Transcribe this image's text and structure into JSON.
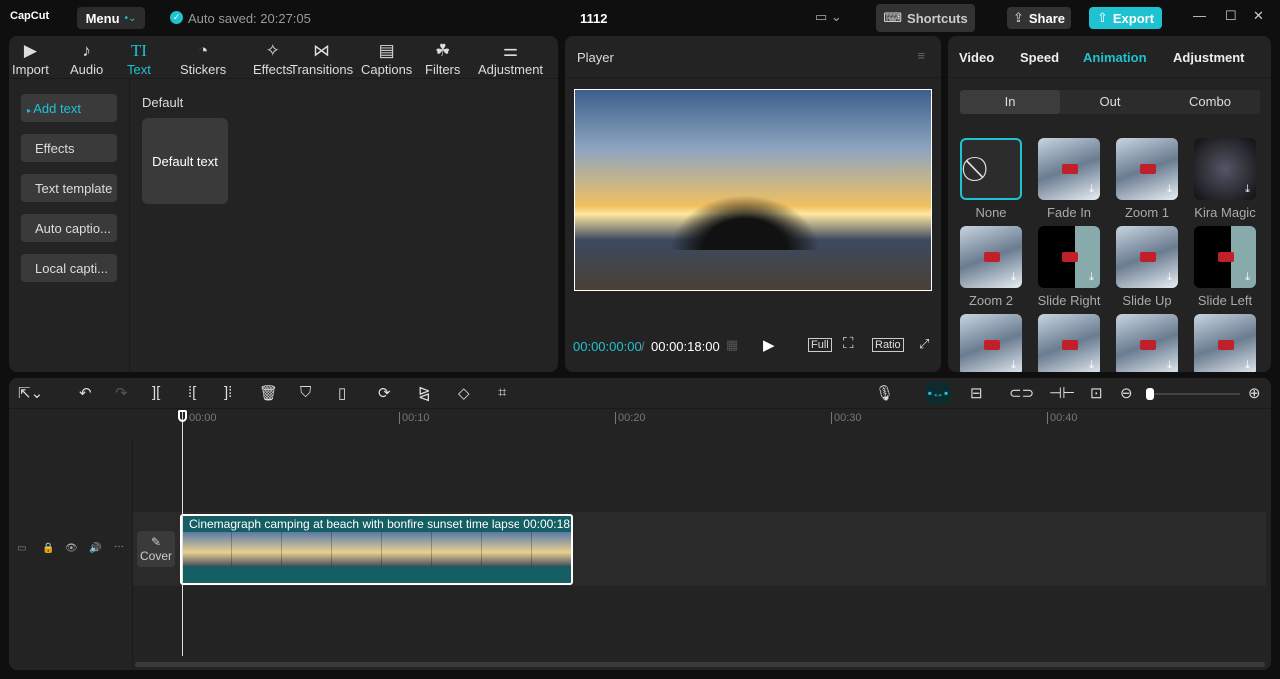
{
  "app": {
    "logo": "CapCut",
    "menu": "Menu",
    "autosave": "Auto saved: 20:27:05",
    "title": "1112",
    "shortcuts": "Shortcuts",
    "share": "Share",
    "export": "Export"
  },
  "toolbar_tabs": [
    {
      "label": "Import",
      "icon": "▶"
    },
    {
      "label": "Audio",
      "icon": "♪"
    },
    {
      "label": "Text",
      "icon": "TI"
    },
    {
      "label": "Stickers",
      "icon": "◔"
    },
    {
      "label": "Effects",
      "icon": "✧"
    },
    {
      "label": "Transitions",
      "icon": "⋈"
    },
    {
      "label": "Captions",
      "icon": "▤"
    },
    {
      "label": "Filters",
      "icon": "☘"
    },
    {
      "label": "Adjustment",
      "icon": "⚌"
    }
  ],
  "active_tab": "Text",
  "text_sidebar": [
    "Add text",
    "Effects",
    "Text template",
    "Auto captio...",
    "Local capti..."
  ],
  "text_panel": {
    "section": "Default",
    "card": "Default text"
  },
  "player": {
    "title": "Player",
    "current": "00:00:00:00",
    "total": "00:00:18:00",
    "full": "Full",
    "ratio": "Ratio"
  },
  "right_tabs": [
    "Video",
    "Speed",
    "Animation",
    "Adjustment"
  ],
  "anim_tabs": [
    "In",
    "Out",
    "Combo"
  ],
  "animations": [
    "None",
    "Fade In",
    "Zoom 1",
    "Kira Magic",
    "Zoom 2",
    "Slide Right",
    "Slide Up",
    "Slide Left"
  ],
  "timeline": {
    "ticks": [
      "00:00",
      "00:10",
      "00:20",
      "00:30",
      "00:40"
    ],
    "clip_title": "Cinemagraph camping at beach with bonfire sunset time lapse",
    "clip_duration": "00:00:18",
    "cover": "Cover"
  },
  "colors": {
    "accent": "#1fc2d0",
    "clip": "#145e64"
  }
}
